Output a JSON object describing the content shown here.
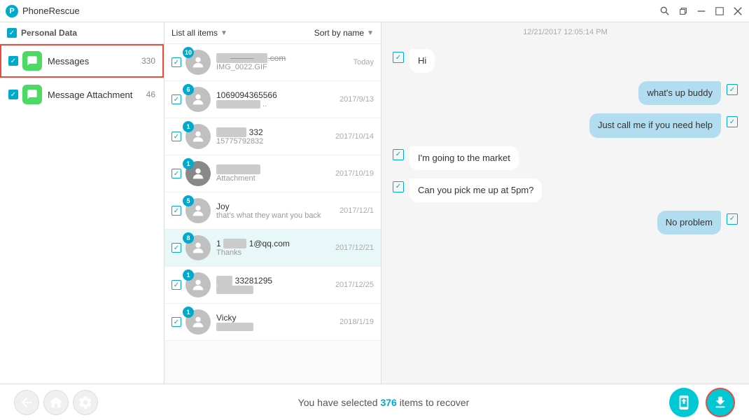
{
  "app": {
    "title": "PhoneRescue",
    "icon": "P"
  },
  "titlebar": {
    "search_icon": "🔍",
    "restore_icon": "⧉",
    "minimize_icon": "–",
    "maximize_icon": "□",
    "close_icon": "✕"
  },
  "sidebar": {
    "header_label": "Personal Data",
    "items": [
      {
        "name": "Messages",
        "count": "330",
        "active": true
      },
      {
        "name": "Message Attachment",
        "count": "46",
        "active": false
      }
    ]
  },
  "middle": {
    "filter_label": "List all items",
    "sort_label": "Sort by name",
    "contacts": [
      {
        "badge": "10",
        "name": ".com",
        "sub": "IMG_0022.GIF",
        "date": "Today",
        "strikethrough": true,
        "selected": false
      },
      {
        "badge": "6",
        "name": "1069094365566",
        "sub": ".. ",
        "date": "2017/9/13",
        "strikethrough": false,
        "selected": false
      },
      {
        "badge": "1",
        "name": "332",
        "sub": "15775792832",
        "date": "2017/10/14",
        "strikethrough": false,
        "selected": false
      },
      {
        "badge": "1",
        "name": "",
        "sub": "Attachment",
        "date": "2017/10/19",
        "strikethrough": false,
        "selected": false
      },
      {
        "badge": "5",
        "name": "Joy",
        "sub": "that's what they want you back",
        "date": "2017/12/1",
        "strikethrough": false,
        "selected": false
      },
      {
        "badge": "8",
        "name": "1@qq.com",
        "sub": "Thanks",
        "date": "2017/12/21",
        "strikethrough": false,
        "selected": true
      },
      {
        "badge": "1",
        "name": "33281295",
        "sub": "",
        "date": "2017/12/25",
        "strikethrough": false,
        "selected": false
      },
      {
        "badge": "1",
        "name": "Vicky",
        "sub": "",
        "date": "2018/1/19",
        "strikethrough": false,
        "selected": false
      }
    ]
  },
  "chat": {
    "timestamp": "12/21/2017 12:05:14 PM",
    "messages": [
      {
        "type": "incoming",
        "text": "Hi"
      },
      {
        "type": "outgoing",
        "text": "what's up buddy"
      },
      {
        "type": "outgoing",
        "text": "Just call me if you need help"
      },
      {
        "type": "incoming",
        "text": "I'm going to the market"
      },
      {
        "type": "incoming",
        "text": "Can you pick me up at 5pm?"
      },
      {
        "type": "outgoing",
        "text": "No problem"
      }
    ]
  },
  "bottom": {
    "status_prefix": "You have selected ",
    "count": "376",
    "status_suffix": " items to recover"
  }
}
